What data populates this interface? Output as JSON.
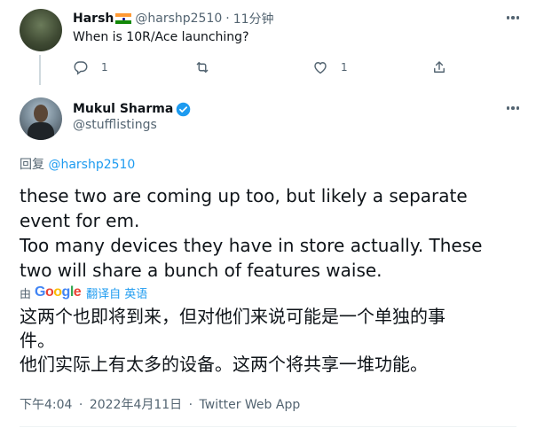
{
  "reply_tweet": {
    "display_name": "Harsh",
    "flag_icon": "india-flag-icon",
    "handle": "@harshp2510",
    "separator": "·",
    "time": "11分钟",
    "text": "When is 10R/Ace launching?",
    "actions": {
      "reply_count": "1",
      "retweet_count": "",
      "like_count": "1"
    }
  },
  "main_tweet": {
    "display_name": "Mukul Sharma",
    "verified": true,
    "handle": "@stufflistings",
    "replying_label": "回复",
    "replying_to": "@harshp2510",
    "text_lines": [
      "these two are coming up too, but likely a separate",
      "event for em.",
      "Too many devices they have in store actually. These",
      "two will share a bunch of features waise."
    ],
    "translation": {
      "by_label": "由",
      "provider": "Google",
      "translated_from": "翻译自 英语"
    },
    "translated_lines": [
      "这两个也即将到来，但对他们来说可能是一个单独的事",
      "件。",
      "他们实际上有太多的设备。这两个将共享一堆功能。"
    ],
    "timestamp": "下午4:04",
    "date": "2022年4月11日",
    "source": "Twitter Web App",
    "separator": "·"
  },
  "colors": {
    "text_primary": "#0f1419",
    "text_secondary": "#536471",
    "accent": "#1d9bf0"
  }
}
